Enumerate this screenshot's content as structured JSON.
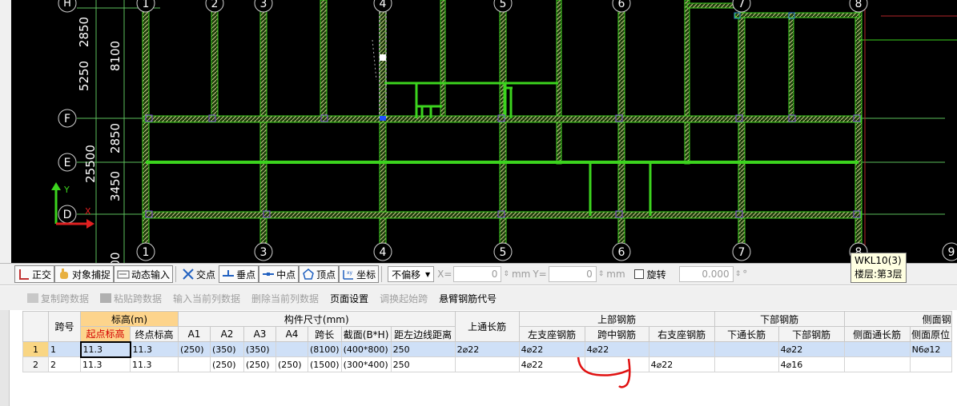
{
  "cad": {
    "axis_top": [
      "1",
      "2",
      "3",
      "4",
      "5",
      "6",
      "7",
      "8"
    ],
    "axis_top_partial": "H",
    "axis_bottom": [
      "1",
      "3",
      "4",
      "5",
      "6",
      "7",
      "8",
      "9"
    ],
    "axis_left": [
      "F",
      "E",
      "D"
    ],
    "dims_outer": [
      "2850",
      "5250",
      "25500"
    ],
    "dims_inner": [
      "8100",
      "2850",
      "3450"
    ],
    "bottom_dim_partial": "00",
    "ucs_y": "Y",
    "ucs_x": "X",
    "colors": {
      "bg": "#000000",
      "axis": "#5dbf5d",
      "beam": "#3cd41e",
      "hatch": "#d8d8a0",
      "node": "#7a3fd0",
      "selected": "#ffffff"
    }
  },
  "tooltip": {
    "line1": "WKL10(3)",
    "line2": "楼层:第3层"
  },
  "snapbar": {
    "ortho": "正交",
    "snap": "对象捕捉",
    "dyn": "动态输入",
    "intersect": "交点",
    "perp": "垂点",
    "mid": "中点",
    "vertex": "顶点",
    "coord": "坐标",
    "offset_mode": "不偏移",
    "x_label": "X=",
    "x_value": "0",
    "x_unit": "mm",
    "y_label": "Y=",
    "y_value": "0",
    "y_unit": "mm",
    "rotate_label": "旋转",
    "rotate_value": "0.000",
    "rotate_unit": "°"
  },
  "editbar": {
    "copy": "复制跨数据",
    "paste": "粘贴跨数据",
    "input_col": "输入当前列数据",
    "del_col": "删除当前列数据",
    "page": "页面设置",
    "swap": "调换起始跨",
    "cantilever": "悬臂钢筋代号"
  },
  "table": {
    "h_span": "跨号",
    "h_elev": "标高(m)",
    "h_dims": "构件尺寸(mm)",
    "h_top_through": "上通长筋",
    "h_top_bars": "上部钢筋",
    "h_bot_bars": "下部钢筋",
    "h_side": "侧面钢",
    "sub": [
      "起点标高",
      "终点标高",
      "A1",
      "A2",
      "A3",
      "A4",
      "跨长",
      "截面(B*H)",
      "距左边线距离",
      "左支座钢筋",
      "跨中钢筋",
      "右支座钢筋",
      "下通长筋",
      "下部钢筋",
      "侧面通长筋",
      "侧面原位"
    ],
    "rows": [
      {
        "n": "1",
        "span": "1",
        "start": "11.3",
        "end": "11.3",
        "a1": "(250)",
        "a2": "(350)",
        "a3": "(350)",
        "a4": "",
        "len": "(8100)",
        "sec": "(400*800)",
        "dist": "250",
        "topthru": "2⌀22",
        "left": "4⌀22",
        "mid": "4⌀22",
        "right": "",
        "botthru": "",
        "bot": "4⌀22",
        "sidethru": "",
        "sideorig": "N6⌀12"
      },
      {
        "n": "2",
        "span": "2",
        "start": "11.3",
        "end": "11.3",
        "a1": "",
        "a2": "(250)",
        "a3": "(250)",
        "a4": "(250)",
        "len": "(1500)",
        "sec": "(300*400)",
        "dist": "250",
        "topthru": "",
        "left": "4⌀22",
        "mid": "",
        "right": "4⌀22",
        "botthru": "",
        "bot": "4⌀16",
        "sidethru": "",
        "sideorig": ""
      }
    ]
  }
}
